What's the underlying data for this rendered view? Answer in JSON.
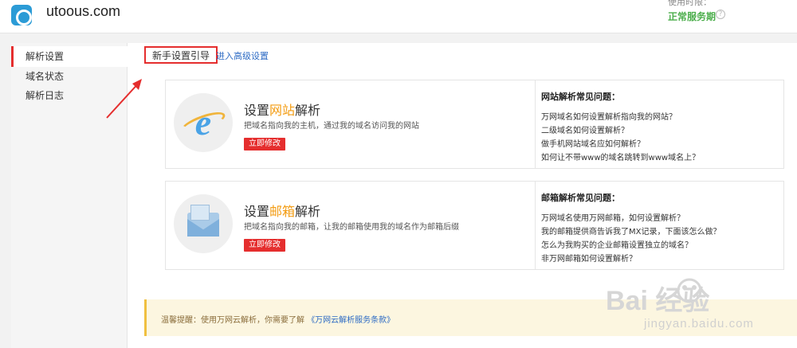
{
  "header": {
    "domain": "utoous.com",
    "status_top": "使用时限：",
    "status": "正常服务期"
  },
  "sidebar": {
    "items": [
      {
        "label": "解析设置",
        "active": true
      },
      {
        "label": "域名状态",
        "active": false
      },
      {
        "label": "解析日志",
        "active": false
      }
    ]
  },
  "tabs": {
    "guide": "新手设置引导",
    "advanced": "进入高级设置"
  },
  "cards": [
    {
      "title_prefix": "设置",
      "title_highlight": "网站",
      "title_suffix": "解析",
      "desc": "把域名指向我的主机，通过我的域名访问我的网站",
      "button": "立即修改",
      "faq_title": "网站解析常见问题：",
      "faq": [
        "万网域名如何设置解析指向我的网站？",
        "二级域名如何设置解析？",
        "做手机网站域名应如何解析？",
        "如何让不带www的域名跳转到www域名上？"
      ]
    },
    {
      "title_prefix": "设置",
      "title_highlight": "邮箱",
      "title_suffix": "解析",
      "desc": "把域名指向我的邮箱，让我的邮箱使用我的域名作为邮箱后缀",
      "button": "立即修改",
      "faq_title": "邮箱解析常见问题：",
      "faq": [
        "万网域名使用万网邮箱，如何设置解析？",
        "我的邮箱提供商告诉我了MX记录，下面该怎么做？",
        "怎么为我购买的企业邮箱设置独立的域名？",
        "非万网邮箱如何设置解析？"
      ]
    }
  ],
  "notice": {
    "text": "温馨提醒：使用万网云解析，你需要了解",
    "link": "《万网云解析服务条款》"
  },
  "watermark": {
    "logo": "Bai 经验",
    "url": "jingyan.baidu.com"
  },
  "colors": {
    "accent_red": "#e52e2e",
    "highlight_orange": "#f39c12",
    "status_green": "#4cae4c",
    "link_blue": "#2d6bc4"
  }
}
